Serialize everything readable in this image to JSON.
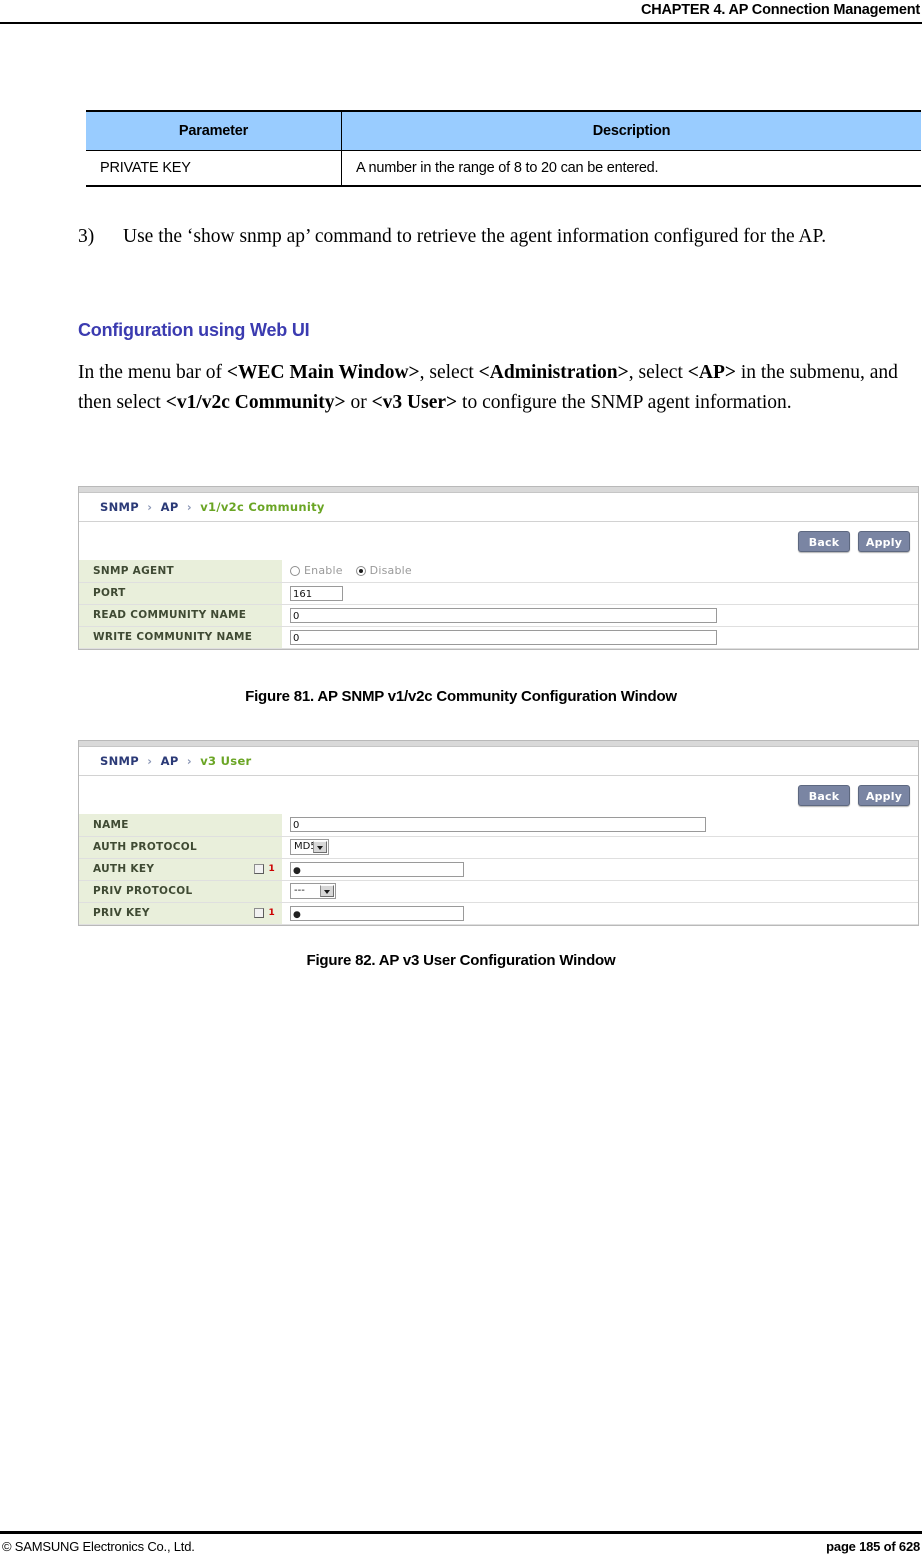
{
  "header": {
    "chapter": "CHAPTER 4. AP Connection Management"
  },
  "param_table": {
    "columns": [
      "Parameter",
      "Description"
    ],
    "header_bg": "#99ccff",
    "rows": [
      {
        "parameter": "PRIVATE KEY",
        "description": "A number in the range of 8 to 20 can be entered."
      }
    ]
  },
  "steps": [
    {
      "number": "3)",
      "text": "Use the ‘show snmp ap’ command to retrieve the agent information configured for the AP."
    }
  ],
  "section": {
    "heading": "Configuration using Web UI",
    "heading_color": "#3b3bb0",
    "paragraph_parts": [
      {
        "text": "In the menu bar of ",
        "bold": false
      },
      {
        "text": "<WEC Main Window>",
        "bold": true
      },
      {
        "text": ", select ",
        "bold": false
      },
      {
        "text": "<Administration>",
        "bold": true
      },
      {
        "text": ", select ",
        "bold": false
      },
      {
        "text": "<AP>",
        "bold": true
      },
      {
        "text": " in the submenu, and then select ",
        "bold": false
      },
      {
        "text": "<v1/v2c Community>",
        "bold": true
      },
      {
        "text": " or ",
        "bold": false
      },
      {
        "text": "<v3 User>",
        "bold": true
      },
      {
        "text": " to configure the SNMP agent information.",
        "bold": false
      }
    ]
  },
  "figure_81": {
    "caption": "Figure 81. AP SNMP v1/v2c Community Configuration Window",
    "breadcrumb": {
      "nodes": [
        "SNMP",
        "AP"
      ],
      "separator": "›",
      "current": "v1/v2c Community"
    },
    "buttons": {
      "back": "Back",
      "apply": "Apply"
    },
    "rows": [
      {
        "label": "SNMP AGENT",
        "type": "radio",
        "options": [
          {
            "label": "Enable",
            "selected": false
          },
          {
            "label": "Disable",
            "selected": true
          }
        ]
      },
      {
        "label": "PORT",
        "type": "text",
        "value": "161",
        "width": "w-port"
      },
      {
        "label": "READ COMMUNITY NAME",
        "type": "text",
        "value": "0",
        "width": "w-wide"
      },
      {
        "label": "WRITE COMMUNITY NAME",
        "type": "text",
        "value": "0",
        "width": "w-wide"
      }
    ]
  },
  "figure_82": {
    "caption": "Figure 82. AP v3 User Configuration Window",
    "breadcrumb": {
      "nodes": [
        "SNMP",
        "AP"
      ],
      "separator": "›",
      "current": "v3 User"
    },
    "buttons": {
      "back": "Back",
      "apply": "Apply"
    },
    "flag_marker": "1",
    "rows": [
      {
        "label": "NAME",
        "type": "text",
        "value": "0",
        "width": "w-name",
        "flag": false
      },
      {
        "label": "AUTH PROTOCOL",
        "type": "select",
        "value": "MD5",
        "width": "sel-md5",
        "flag": false
      },
      {
        "label": "AUTH KEY",
        "type": "password",
        "value": "●",
        "width": "w-key",
        "flag": true
      },
      {
        "label": "PRIV PROTOCOL",
        "type": "select",
        "value": "---",
        "width": "sel-priv",
        "flag": false
      },
      {
        "label": "PRIV KEY",
        "type": "password",
        "value": "●",
        "width": "w-key",
        "flag": true
      }
    ]
  },
  "footer": {
    "copyright": "© SAMSUNG Electronics Co., Ltd.",
    "page": "page 185 of 628"
  }
}
